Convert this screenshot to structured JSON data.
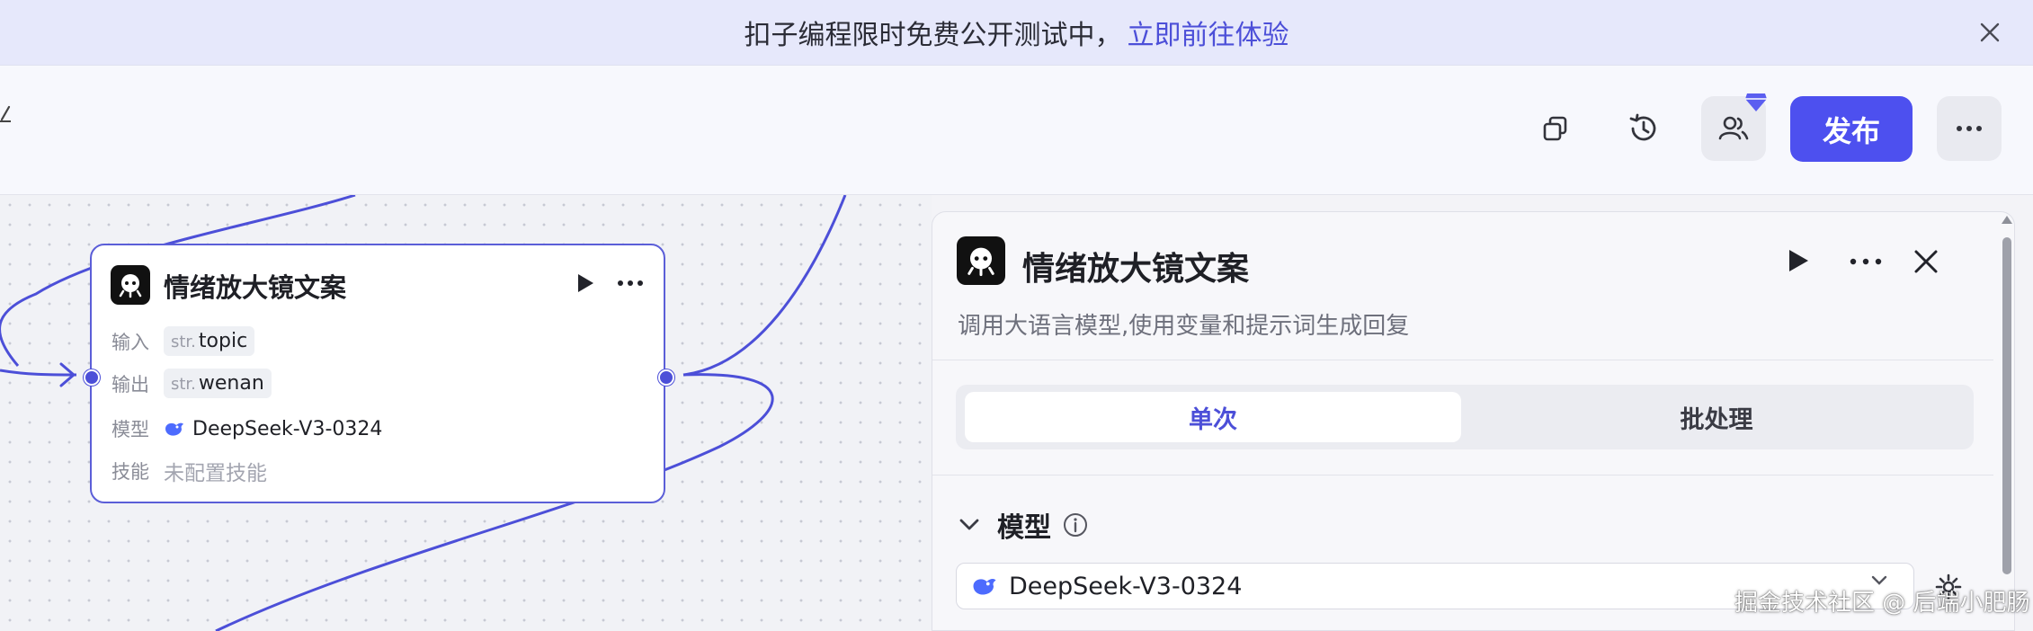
{
  "banner": {
    "text": "扣子编程限时免费公开测试中，",
    "link": "立即前往体验"
  },
  "toolbar": {
    "publish_label": "发布"
  },
  "node": {
    "title": "情绪放大镜文案",
    "input_label": "输入",
    "input_type": "str.",
    "input_value": "topic",
    "output_label": "输出",
    "output_type": "str.",
    "output_value": "wenan",
    "model_label": "模型",
    "model_value": "DeepSeek-V3-0324",
    "skill_label": "技能",
    "skill_value": "未配置技能"
  },
  "panel": {
    "title": "情绪放大镜文案",
    "description": "调用大语言模型,使用变量和提示词生成回复",
    "tabs": [
      {
        "label": "单次",
        "active": true
      },
      {
        "label": "批处理",
        "active": false
      }
    ],
    "section_title": "模型",
    "model_value": "DeepSeek-V3-0324"
  },
  "watermark": "掘金技术社区 @ 后端小肥肠",
  "colors": {
    "accent": "#4d50ef",
    "banner_bg": "#e6e8fb",
    "edge": "#4c4fd8"
  }
}
